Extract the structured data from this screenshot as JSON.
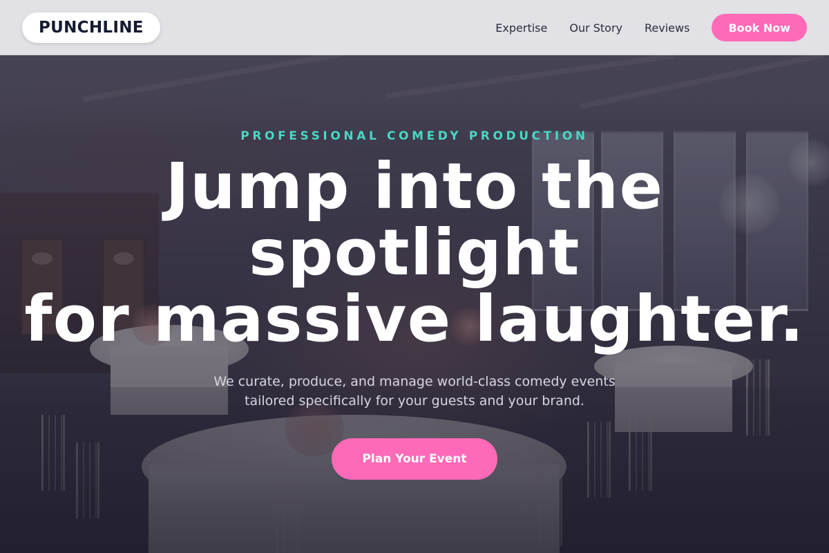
{
  "header": {
    "logo_text": "PUNCHLINE",
    "nav": [
      {
        "label": "Expertise"
      },
      {
        "label": "Our Story"
      },
      {
        "label": "Reviews"
      }
    ],
    "cta_label": "Book Now"
  },
  "hero": {
    "eyebrow": "PROFESSIONAL COMEDY PRODUCTION",
    "headline_lines": [
      "Jump into the",
      "spotlight",
      "for massive laughter."
    ],
    "subtext_lines": [
      "We curate, produce, and manage world-class comedy events",
      "tailored specifically for your guests and your brand."
    ],
    "cta_label": "Plan Your Event",
    "background_image": "banquet-hall-photo"
  },
  "colors": {
    "accent_pink": "#ff6ab8",
    "eyebrow_teal": "#49d8c3",
    "logo_text": "#141a30",
    "header_bg": "#e2e1e6"
  }
}
